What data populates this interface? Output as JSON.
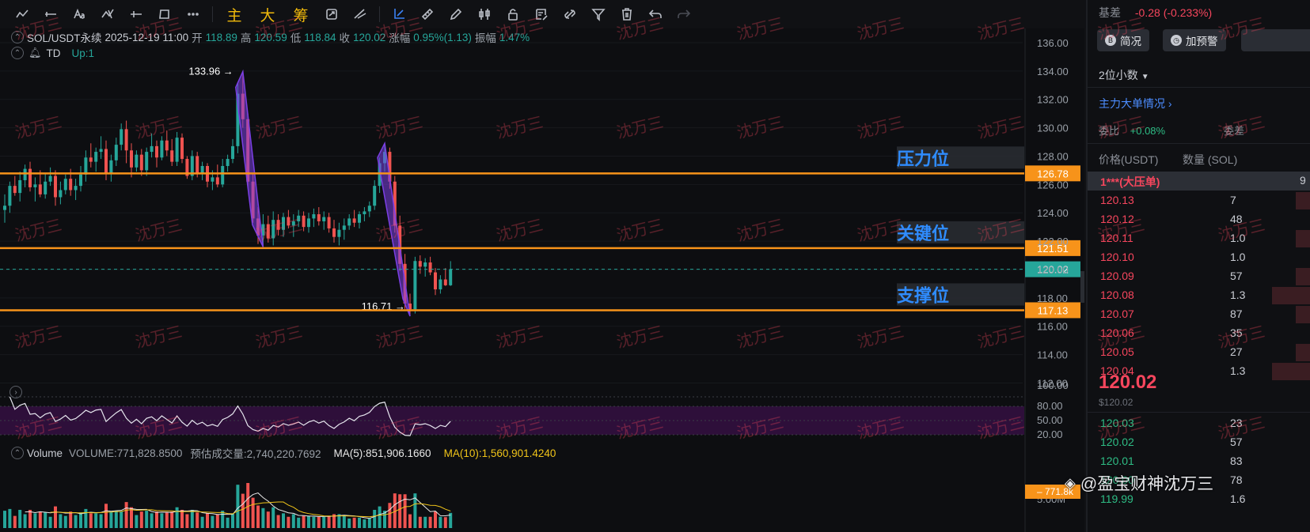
{
  "toolbar": {
    "icons": [
      "trendline-icon",
      "horizontal-line-icon",
      "text-icon",
      "brush-icon",
      "ray-icon",
      "rectangle-icon",
      "more-icon"
    ],
    "indicators": [
      "主",
      "大",
      "筹"
    ],
    "tools": [
      "magnet-sync-icon",
      "measure-icon",
      "crosshair-icon",
      "ruler-icon",
      "pen-icon",
      "candles-icon",
      "lock-icon",
      "note-icon",
      "link-icon",
      "filter-icon",
      "trash-icon",
      "undo-icon",
      "redo-icon"
    ]
  },
  "info": {
    "symbol": "SOL/USDT永续",
    "datetime": "2025-12-19 11:00",
    "open_label": "开",
    "open": "118.89",
    "high_label": "高",
    "high": "120.59",
    "low_label": "低",
    "low": "118.84",
    "close_label": "收",
    "close": "120.02",
    "change_label": "涨幅",
    "change": "0.95%(1.13)",
    "amp_label": "振幅",
    "amp": "1.47%",
    "td_label": "TD",
    "td_value": "Up:1"
  },
  "volume_info": {
    "label": "Volume",
    "volume": "VOLUME:771,828.8500",
    "estimate": "预估成交量:2,740,220.7692",
    "ma5": "MA(5):851,906.1660",
    "ma10": "MA(10):1,560,901.4240"
  },
  "colors": {
    "up": "#26a69a",
    "down": "#ef5350",
    "level": "#f7931a",
    "wave": "#7b3fe4",
    "rsi_bg": "#2e0f3a",
    "ma5": "#e8e8e8",
    "ma10": "#f0c419"
  },
  "watermark": "沈万三",
  "credit": "@盈宝财神沈万三",
  "chart_data": {
    "type": "candlestick",
    "ylim": [
      110.8,
      137.0
    ],
    "yticks": [
      "136.00",
      "134.00",
      "132.00",
      "130.00",
      "128.00",
      "126.00",
      "124.00",
      "122.00",
      "120.00",
      "118.00",
      "116.00",
      "114.00",
      "112.00"
    ],
    "last_price": "120.02",
    "levels": [
      {
        "label": "压力位",
        "price": 126.78,
        "text": "126.78"
      },
      {
        "label": "关键位",
        "price": 121.51,
        "text": "121.51"
      },
      {
        "label": "支撑位",
        "price": 117.13,
        "text": "117.13"
      }
    ],
    "annotations": [
      {
        "text": "133.96",
        "price": 133.96
      },
      {
        "text": "116.71",
        "price": 116.71
      }
    ],
    "candles": [
      [
        124.2,
        125.3,
        123.3,
        124.5
      ],
      [
        124.5,
        126.2,
        124.0,
        125.9
      ],
      [
        125.9,
        126.6,
        125.2,
        125.4
      ],
      [
        125.4,
        126.9,
        124.8,
        126.3
      ],
      [
        126.3,
        127.4,
        125.8,
        127.1
      ],
      [
        127.1,
        127.6,
        125.5,
        125.8
      ],
      [
        125.8,
        126.5,
        124.8,
        126.0
      ],
      [
        126.0,
        127.0,
        125.1,
        125.3
      ],
      [
        125.3,
        126.8,
        125.0,
        126.2
      ],
      [
        126.2,
        127.2,
        125.9,
        126.6
      ],
      [
        126.6,
        127.0,
        124.5,
        125.1
      ],
      [
        125.1,
        126.2,
        124.6,
        125.6
      ],
      [
        125.6,
        126.7,
        125.3,
        126.4
      ],
      [
        126.4,
        127.1,
        125.2,
        125.6
      ],
      [
        125.6,
        126.4,
        124.9,
        125.9
      ],
      [
        125.9,
        127.3,
        125.5,
        126.7
      ],
      [
        126.7,
        128.4,
        126.2,
        127.9
      ],
      [
        127.9,
        128.9,
        127.2,
        127.6
      ],
      [
        127.6,
        128.6,
        126.9,
        128.3
      ],
      [
        128.3,
        129.4,
        127.8,
        128.5
      ],
      [
        128.5,
        129.1,
        126.3,
        126.8
      ],
      [
        126.8,
        128.1,
        126.2,
        127.7
      ],
      [
        127.7,
        129.3,
        127.3,
        128.8
      ],
      [
        128.8,
        130.3,
        128.4,
        129.9
      ],
      [
        129.9,
        130.5,
        127.5,
        128.4
      ],
      [
        128.4,
        128.9,
        126.5,
        127.2
      ],
      [
        127.2,
        128.4,
        126.9,
        128.1
      ],
      [
        128.1,
        128.5,
        126.6,
        127.0
      ],
      [
        127.0,
        128.6,
        126.6,
        128.3
      ],
      [
        128.3,
        129.6,
        127.9,
        128.7
      ],
      [
        128.7,
        129.1,
        127.2,
        127.9
      ],
      [
        127.9,
        129.4,
        127.7,
        129.1
      ],
      [
        129.1,
        129.8,
        128.0,
        128.4
      ],
      [
        128.4,
        129.2,
        127.3,
        127.6
      ],
      [
        127.6,
        129.7,
        127.3,
        129.3
      ],
      [
        129.3,
        129.6,
        127.5,
        127.8
      ],
      [
        127.8,
        128.0,
        126.4,
        126.6
      ],
      [
        126.6,
        128.4,
        126.3,
        128.0
      ],
      [
        128.0,
        128.3,
        126.5,
        126.8
      ],
      [
        126.8,
        127.6,
        126.3,
        127.3
      ],
      [
        127.3,
        127.5,
        125.8,
        126.2
      ],
      [
        126.2,
        127.0,
        125.6,
        126.5
      ],
      [
        126.5,
        127.4,
        125.8,
        126.0
      ],
      [
        126.0,
        127.8,
        125.8,
        127.3
      ],
      [
        127.3,
        128.1,
        126.9,
        127.8
      ],
      [
        127.8,
        129.2,
        127.5,
        128.7
      ],
      [
        128.7,
        133.2,
        128.2,
        132.4
      ],
      [
        132.4,
        133.96,
        130.0,
        130.6
      ],
      [
        130.6,
        131.0,
        125.8,
        126.2
      ],
      [
        126.2,
        126.8,
        123.3,
        123.6
      ],
      [
        123.6,
        124.4,
        121.8,
        122.4
      ],
      [
        122.4,
        123.9,
        121.6,
        123.2
      ],
      [
        123.2,
        123.8,
        121.9,
        122.2
      ],
      [
        122.2,
        124.1,
        121.7,
        123.5
      ],
      [
        123.5,
        123.9,
        122.4,
        122.8
      ],
      [
        122.8,
        124.0,
        122.3,
        123.7
      ],
      [
        123.7,
        124.2,
        122.9,
        123.1
      ],
      [
        123.1,
        123.9,
        122.3,
        123.4
      ],
      [
        123.4,
        124.2,
        123.0,
        123.8
      ],
      [
        123.8,
        124.1,
        122.7,
        123.0
      ],
      [
        123.0,
        124.0,
        122.6,
        123.6
      ],
      [
        123.6,
        124.3,
        123.0,
        123.9
      ],
      [
        123.9,
        124.4,
        123.1,
        123.4
      ],
      [
        123.4,
        124.1,
        122.8,
        123.7
      ],
      [
        123.7,
        124.0,
        122.6,
        122.9
      ],
      [
        122.9,
        123.5,
        121.9,
        122.3
      ],
      [
        122.3,
        123.3,
        121.7,
        122.8
      ],
      [
        122.8,
        123.6,
        122.1,
        123.1
      ],
      [
        123.1,
        123.9,
        122.8,
        123.6
      ],
      [
        123.6,
        124.2,
        123.0,
        123.3
      ],
      [
        123.3,
        124.1,
        122.9,
        123.9
      ],
      [
        123.9,
        124.4,
        123.4,
        124.1
      ],
      [
        124.1,
        124.8,
        123.7,
        124.5
      ],
      [
        124.5,
        126.3,
        124.2,
        125.9
      ],
      [
        125.9,
        127.9,
        125.4,
        127.5
      ],
      [
        127.5,
        128.9,
        126.9,
        128.3
      ],
      [
        128.3,
        128.6,
        125.7,
        126.2
      ],
      [
        126.2,
        126.6,
        122.6,
        123.1
      ],
      [
        123.1,
        123.8,
        119.9,
        120.4
      ],
      [
        120.4,
        121.1,
        117.2,
        117.6
      ],
      [
        117.6,
        118.3,
        116.71,
        117.2
      ],
      [
        117.2,
        120.9,
        116.9,
        120.6
      ],
      [
        120.6,
        121.0,
        119.7,
        120.2
      ],
      [
        120.2,
        120.8,
        119.5,
        120.5
      ],
      [
        120.5,
        120.9,
        119.6,
        119.8
      ],
      [
        119.8,
        120.1,
        118.2,
        118.6
      ],
      [
        118.6,
        119.6,
        118.3,
        119.3
      ],
      [
        119.3,
        120.1,
        118.84,
        118.89
      ],
      [
        118.89,
        120.59,
        118.84,
        120.02
      ]
    ],
    "rsi": {
      "levels": [
        "100.00",
        "80.00",
        "50.00",
        "20.00"
      ]
    },
    "volume_axis": "5.00M",
    "volume_last": "771.8k"
  },
  "panel": {
    "basis_label": "基差",
    "basis_value": "-0.28 (-0.233%)",
    "btn_brief": "简况",
    "btn_alert": "加预警",
    "decimals": "2位小数",
    "bigorder": "主力大单情况",
    "ratio_label": "委比",
    "ratio_value": "+0.08%",
    "ratio_right": "委差",
    "col_price": "价格(USDT)",
    "col_qty": "数量 (SOL)",
    "big_label": "1***(大压单)",
    "big_qty": "9",
    "asks": [
      {
        "p": "120.13",
        "q": "7"
      },
      {
        "p": "120.12",
        "q": "48"
      },
      {
        "p": "120.11",
        "q": "1.0"
      },
      {
        "p": "120.10",
        "q": "1.0"
      },
      {
        "p": "120.09",
        "q": "57"
      },
      {
        "p": "120.08",
        "q": "1.3"
      },
      {
        "p": "120.07",
        "q": "87"
      },
      {
        "p": "120.06",
        "q": "35"
      },
      {
        "p": "120.05",
        "q": "27"
      },
      {
        "p": "120.04",
        "q": "1.3"
      }
    ],
    "mid_price": "120.02",
    "mid_usd": "$120.02",
    "bids": [
      {
        "p": "120.03",
        "q": "23"
      },
      {
        "p": "120.02",
        "q": "57"
      },
      {
        "p": "120.01",
        "q": "83"
      },
      {
        "p": "120.00",
        "q": "78"
      },
      {
        "p": "119.99",
        "q": "1.6"
      }
    ]
  }
}
